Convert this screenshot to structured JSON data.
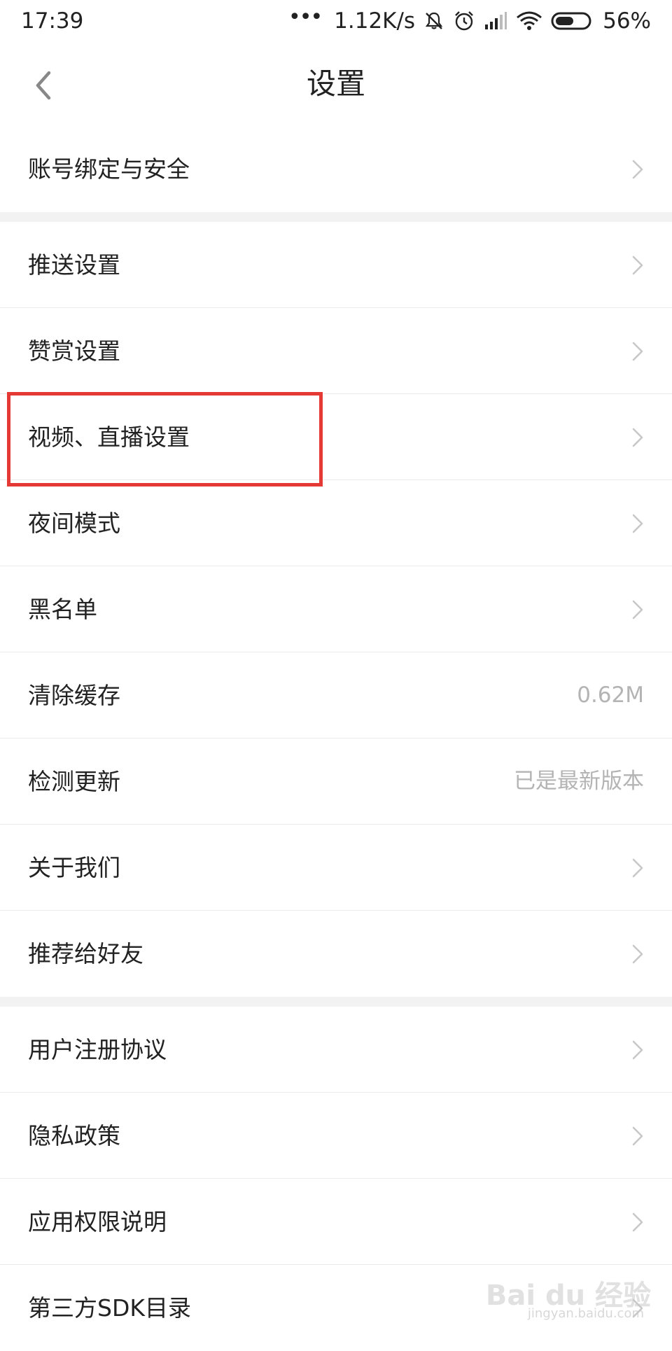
{
  "status_bar": {
    "time": "17:39",
    "dots": "•••",
    "network_speed": "1.12K/s",
    "battery_percent": "56%",
    "battery_level": 0.56,
    "icons": [
      "mute-icon",
      "alarm-icon",
      "signal-icon",
      "wifi-icon",
      "battery-icon"
    ]
  },
  "nav": {
    "title": "设置",
    "back_icon": "chevron-left-icon"
  },
  "groups": [
    {
      "items": [
        {
          "label": "账号绑定与安全",
          "trailing": "chevron"
        }
      ]
    },
    {
      "items": [
        {
          "label": "推送设置",
          "trailing": "chevron"
        },
        {
          "label": "赞赏设置",
          "trailing": "chevron"
        },
        {
          "label": "视频、直播设置",
          "trailing": "chevron"
        },
        {
          "label": "夜间模式",
          "trailing": "chevron"
        },
        {
          "label": "黑名单",
          "trailing": "chevron"
        },
        {
          "label": "清除缓存",
          "value": "0.62M"
        },
        {
          "label": "检测更新",
          "value": "已是最新版本"
        },
        {
          "label": "关于我们",
          "trailing": "chevron"
        },
        {
          "label": "推荐给好友",
          "trailing": "chevron"
        }
      ]
    },
    {
      "items": [
        {
          "label": "用户注册协议",
          "trailing": "chevron"
        },
        {
          "label": "隐私政策",
          "trailing": "chevron"
        },
        {
          "label": "应用权限说明",
          "trailing": "chevron"
        },
        {
          "label": "第三方SDK目录",
          "trailing": "chevron"
        }
      ]
    }
  ],
  "highlight": {
    "target": "视频、直播设置",
    "color": "#e53935"
  },
  "watermark": {
    "text": "Bai du 经验",
    "url_text": "jingyan.baidu.com"
  },
  "colors": {
    "text": "#222222",
    "secondary_text": "#b4b4b4",
    "divider": "#ececec",
    "group_gap": "#f2f2f2",
    "highlight": "#e53935"
  }
}
